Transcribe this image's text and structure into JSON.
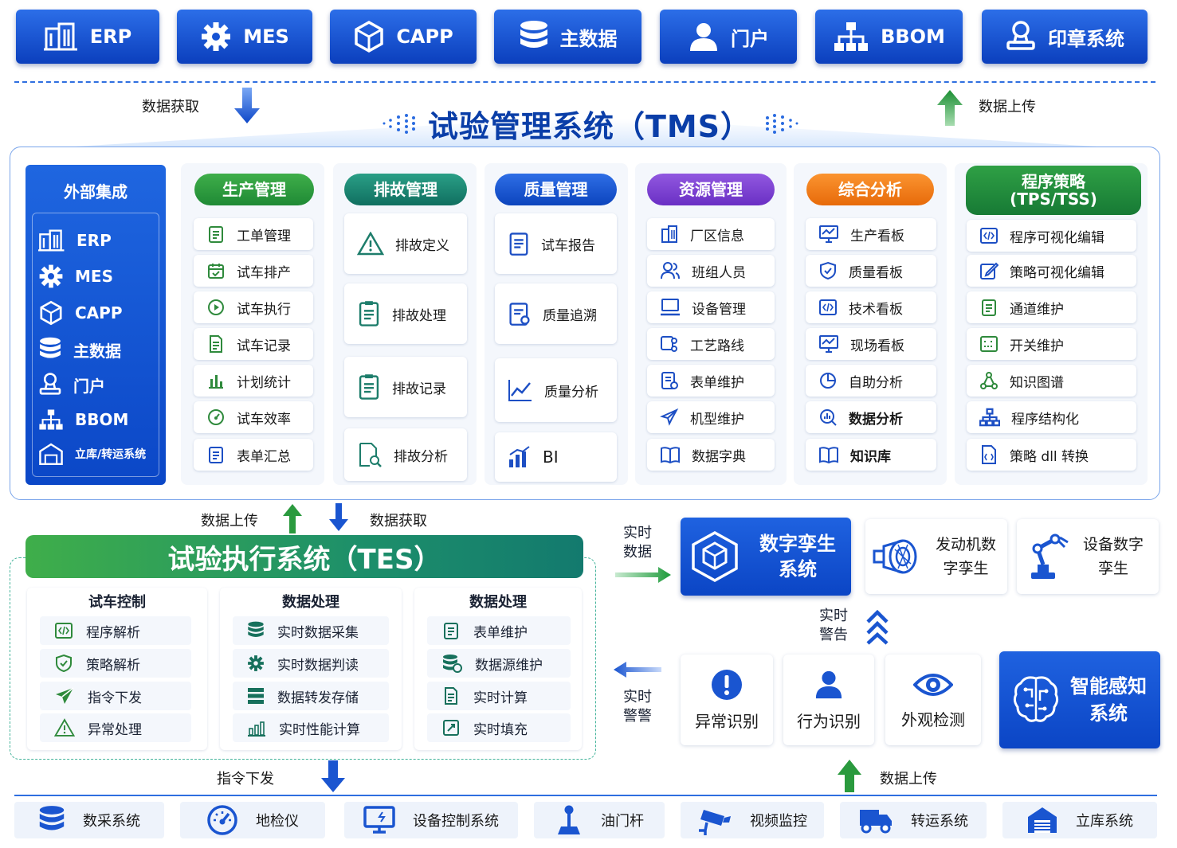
{
  "top_systems": [
    {
      "label": "ERP",
      "icon": "building-icon"
    },
    {
      "label": "MES",
      "icon": "gear-icon"
    },
    {
      "label": "CAPP",
      "icon": "cube-icon"
    },
    {
      "label": "主数据",
      "icon": "database-icon"
    },
    {
      "label": "门户",
      "icon": "user-icon"
    },
    {
      "label": "BBOM",
      "icon": "hierarchy-icon"
    },
    {
      "label": "印章系统",
      "icon": "stamp-icon"
    }
  ],
  "flow": {
    "top_get": "数据获取",
    "top_upload": "数据上传",
    "mid_upload": "数据上传",
    "mid_get": "数据获取",
    "realtime_data": "实时数据",
    "realtime_alert_top": "实时警告",
    "realtime_alert_left": "实时警警",
    "cmd_issue": "指令下发",
    "bottom_upload": "数据上传"
  },
  "tms": {
    "title": "试验管理系统（TMS）",
    "external": {
      "title": "外部集成",
      "items": [
        "ERP",
        "MES",
        "CAPP",
        "主数据",
        "门户",
        "BBOM",
        "立库/转运系统"
      ]
    },
    "modules": [
      {
        "title": "生产管理",
        "color": "#2e9a3c",
        "items": [
          "工单管理",
          "试车排产",
          "试车执行",
          "试车记录",
          "计划统计",
          "试车效率",
          "表单汇总"
        ]
      },
      {
        "title": "排故管理",
        "color": "#16806e",
        "items": [
          "排故定义",
          "排故处理",
          "排故记录",
          "排故分析"
        ]
      },
      {
        "title": "质量管理",
        "color": "#1251c9",
        "items": [
          "试车报告",
          "质量追溯",
          "质量分析",
          "BI"
        ]
      },
      {
        "title": "资源管理",
        "color": "#7a3fd0",
        "items": [
          "厂区信息",
          "班组人员",
          "设备管理",
          "工艺路线",
          "表单维护",
          "机型维护",
          "数据字典"
        ]
      },
      {
        "title": "综合分析",
        "color": "#f07a14",
        "items": [
          "生产看板",
          "质量看板",
          "技术看板",
          "现场看板",
          "自助分析",
          "数据分析",
          "知识库"
        ]
      },
      {
        "title": "程序策略",
        "subtitle": "(TPS/TSS)",
        "color": "#1f8a3a",
        "items": [
          "程序可视化编辑",
          "策略可视化编辑",
          "通道维护",
          "开关维护",
          "知识图谱",
          "程序结构化",
          "策略 dll 转换"
        ]
      }
    ]
  },
  "tes": {
    "title": "试验执行系统（TES）",
    "columns": [
      {
        "title": "试车控制",
        "items": [
          "程序解析",
          "策略解析",
          "指令下发",
          "异常处理"
        ]
      },
      {
        "title": "数据处理",
        "items": [
          "实时数据采集",
          "实时数据判读",
          "数据转发存储",
          "实时性能计算"
        ]
      },
      {
        "title": "数据处理",
        "items": [
          "表单维护",
          "数据源维护",
          "实时计算",
          "实时填充"
        ]
      }
    ]
  },
  "digital_twin": {
    "title": "数字孪生系统",
    "items": [
      "发动机数字孪生",
      "设备数字孪生"
    ]
  },
  "perception": {
    "title": "智能感知系统",
    "items": [
      "异常识别",
      "行为识别",
      "外观检测"
    ]
  },
  "bottom_systems": [
    "数采系统",
    "地检仪",
    "设备控制系统",
    "油门杆",
    "视频监控",
    "转运系统",
    "立库系统"
  ]
}
